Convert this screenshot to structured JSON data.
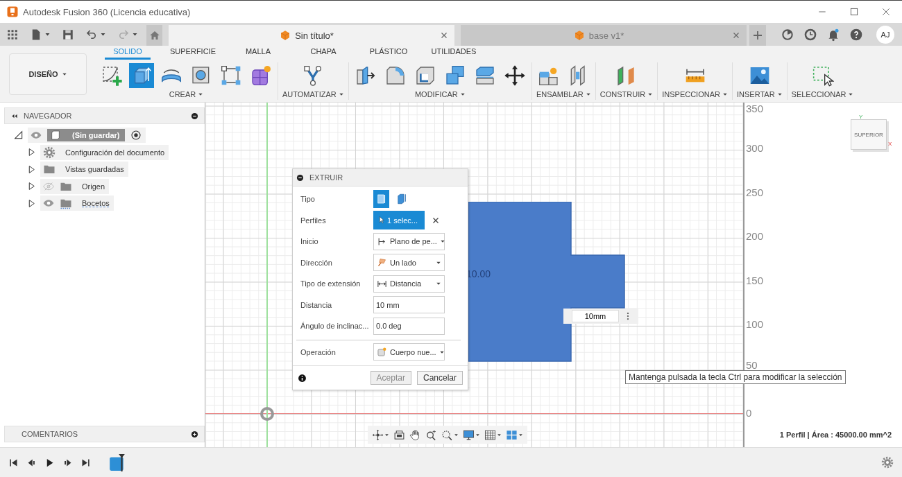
{
  "window": {
    "title": "Autodesk Fusion 360 (Licencia educativa)"
  },
  "document_tabs": [
    {
      "label": "Sin título*",
      "selected": true
    },
    {
      "label": "base v1*",
      "selected": false
    }
  ],
  "user": {
    "initials": "AJ"
  },
  "workspace": {
    "label": "DISEÑO"
  },
  "ribbon_tabs": [
    {
      "label": "SOLIDO",
      "selected": true
    },
    {
      "label": "SUPERFICIE",
      "selected": false
    },
    {
      "label": "MALLA",
      "selected": false
    },
    {
      "label": "CHAPA",
      "selected": false
    },
    {
      "label": "PLÁSTICO",
      "selected": false
    },
    {
      "label": "UTILIDADES",
      "selected": false
    }
  ],
  "tool_groups": [
    {
      "label": "CREAR",
      "tools": [
        {
          "kind": "sketch",
          "selected": false
        },
        {
          "kind": "extrude",
          "selected": true
        },
        {
          "kind": "revolve",
          "selected": false
        },
        {
          "kind": "hole",
          "selected": false
        },
        {
          "kind": "pattern",
          "selected": false
        },
        {
          "kind": "form",
          "selected": false
        }
      ]
    },
    {
      "label": "AUTOMATIZAR",
      "tools": [
        {
          "kind": "automate",
          "selected": false
        }
      ]
    },
    {
      "label": "MODIFICAR",
      "tools": [
        {
          "kind": "press",
          "selected": false
        },
        {
          "kind": "fillet",
          "selected": false
        },
        {
          "kind": "shell",
          "selected": false
        },
        {
          "kind": "combine",
          "selected": false
        },
        {
          "kind": "offset",
          "selected": false
        },
        {
          "kind": "move",
          "selected": false
        }
      ]
    },
    {
      "label": "ENSAMBLAR",
      "tools": [
        {
          "kind": "component",
          "selected": false
        },
        {
          "kind": "joint",
          "selected": false
        }
      ]
    },
    {
      "label": "CONSTRUIR",
      "tools": [
        {
          "kind": "plane",
          "selected": false
        }
      ]
    },
    {
      "label": "INSPECCIONAR",
      "tools": [
        {
          "kind": "measure",
          "selected": false
        }
      ]
    },
    {
      "label": "INSERTAR",
      "tools": [
        {
          "kind": "image",
          "selected": false
        }
      ]
    },
    {
      "label": "SELECCIONAR",
      "tools": [
        {
          "kind": "select",
          "selected": false
        }
      ]
    }
  ],
  "browser": {
    "title": "NAVEGADOR",
    "tree": [
      {
        "label": "(Sin guardar)",
        "kind": "component",
        "visible": true,
        "expanded": true,
        "children": [
          {
            "label": "Configuración del documento",
            "kind": "settings",
            "expanded": false
          },
          {
            "label": "Vistas guardadas",
            "kind": "folder",
            "expanded": false
          },
          {
            "label": "Origen",
            "kind": "folder",
            "visible": false,
            "expanded": false
          },
          {
            "label": "Bocetos",
            "kind": "sketches",
            "visible": true,
            "expanded": false
          }
        ]
      }
    ]
  },
  "comments": {
    "title": "COMENTARIOS"
  },
  "dialog": {
    "title": "EXTRUIR",
    "rows": [
      {
        "kind": "toggle",
        "label": "Tipo",
        "options": [
          {
            "selected": true
          },
          {
            "selected": false
          }
        ]
      },
      {
        "kind": "selection",
        "label": "Perfiles",
        "value": "1 selec..."
      },
      {
        "kind": "dropdown",
        "label": "Inicio",
        "value": "Plano de pe..."
      },
      {
        "kind": "dropdown",
        "label": "Dirección",
        "value": "Un lado"
      },
      {
        "kind": "dropdown",
        "label": "Tipo de extensión",
        "value": "Distancia"
      },
      {
        "kind": "input",
        "label": "Distancia",
        "value": "10 mm"
      },
      {
        "kind": "input",
        "label": "Ángulo de inclinac...",
        "value": "0.0 deg"
      },
      {
        "kind": "dropdown",
        "label": "Operación",
        "value": "Cuerpo nue..."
      }
    ],
    "buttons": [
      {
        "label": "Aceptar",
        "disabled": true
      },
      {
        "label": "Cancelar",
        "disabled": false
      }
    ]
  },
  "canvas": {
    "ruler_labels": [
      "350",
      "300",
      "250",
      "200",
      "150",
      "100",
      "50",
      "0"
    ],
    "dimension_label": "10.00",
    "dimension_input": {
      "value": "10mm"
    },
    "tooltip": "Mantenga pulsada la tecla Ctrl para modificar la selección",
    "view_cube": {
      "face": "SUPERIOR",
      "axes": [
        "Y",
        "X"
      ]
    }
  },
  "status": "1 Perfil | Área : 45000.00 mm^2"
}
